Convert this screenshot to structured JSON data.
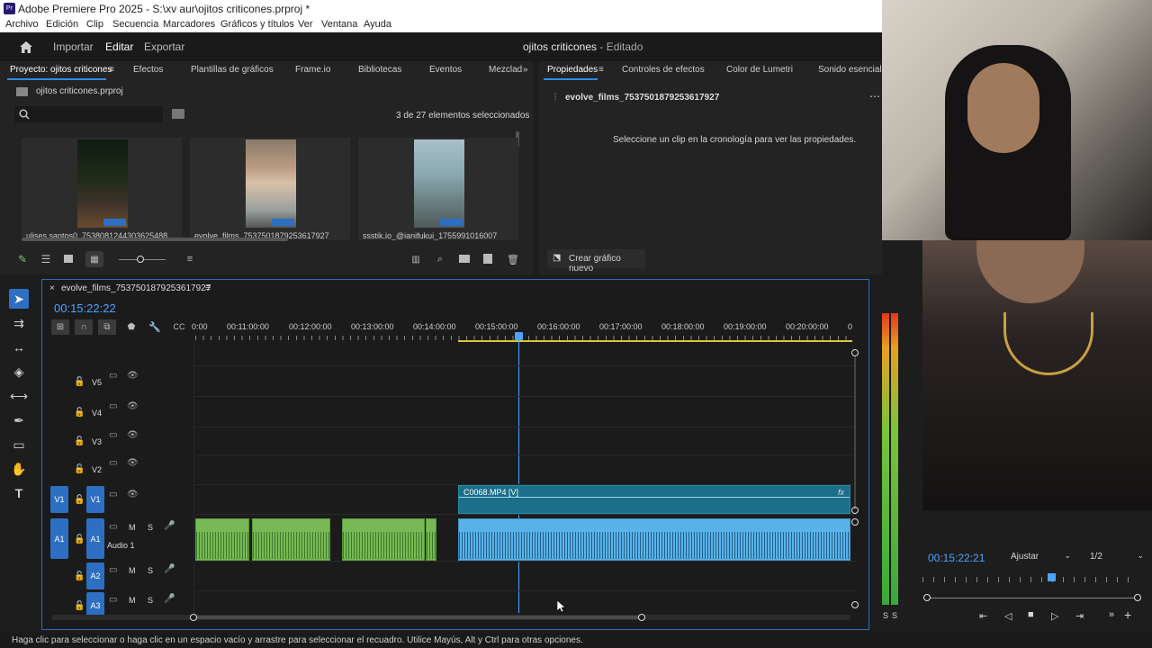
{
  "window": {
    "title": "Adobe Premiere Pro 2025 - S:\\xv aur\\ojitos criticones.prproj *",
    "app_icon": "Pr"
  },
  "menu": [
    "Archivo",
    "Edición",
    "Clip",
    "Secuencia",
    "Marcadores",
    "Gráficos y títulos",
    "Ver",
    "Ventana",
    "Ayuda"
  ],
  "header": {
    "import": "Importar",
    "edit": "Editar",
    "export": "Exportar",
    "project_name": "ojitos criticones",
    "status": " - Editado"
  },
  "project_panel": {
    "tabs": [
      "Proyecto: ojitos criticones",
      "Efectos",
      "Plantillas de gráficos",
      "Frame.io",
      "Bibliotecas",
      "Eventos",
      "Mezclad"
    ],
    "file": "ojitos criticones.prproj",
    "selection": "3 de 27 elementos seleccionados",
    "items": [
      {
        "label": "ulises santos0_7538081244303625488"
      },
      {
        "label": "evolve_films_7537501879253617927"
      },
      {
        "label": "ssstik.io_@ianifukui_1755991016007"
      }
    ]
  },
  "properties_panel": {
    "tabs": [
      "Propiedades",
      "Controles de efectos",
      "Color de Lumetri",
      "Sonido esencial"
    ],
    "clip_name": "evolve_films_7537501879253617927",
    "message": "Seleccione un clip en la cronología para ver las propiedades.",
    "new_graphic": "Crear gráfico nuevo"
  },
  "timeline": {
    "sequence_name": "evolve_films_7537501879253617927",
    "timecode": "00:15:22:22",
    "ruler": [
      "0:00",
      "00:11:00:00",
      "00:12:00:00",
      "00:13:00:00",
      "00:14:00:00",
      "00:15:00:00",
      "00:16:00:00",
      "00:17:00:00",
      "00:18:00:00",
      "00:19:00:00",
      "00:20:00:00",
      "0"
    ],
    "video_tracks": [
      "V5",
      "V4",
      "V3",
      "V2",
      "V1"
    ],
    "audio_tracks": [
      "A1",
      "A2",
      "A3"
    ],
    "v1_source": "V1",
    "a1_source": "A1",
    "audio_track_name": "Audio 1",
    "mute_label": "M",
    "solo_label": "S",
    "video_clip": "C0068.MP4 [V]",
    "fx_label": "fx"
  },
  "monitor": {
    "timecode": "00:15:22:21",
    "fit": "Ajustar",
    "resolution": "1/2"
  },
  "meter": {
    "labels": [
      "S",
      "S"
    ]
  },
  "status_bar": "Haga clic para seleccionar o haga clic en un espacio vacío y arrastre para seleccionar el recuadro. Utilice Mayús, Alt y Ctrl para otras opciones."
}
